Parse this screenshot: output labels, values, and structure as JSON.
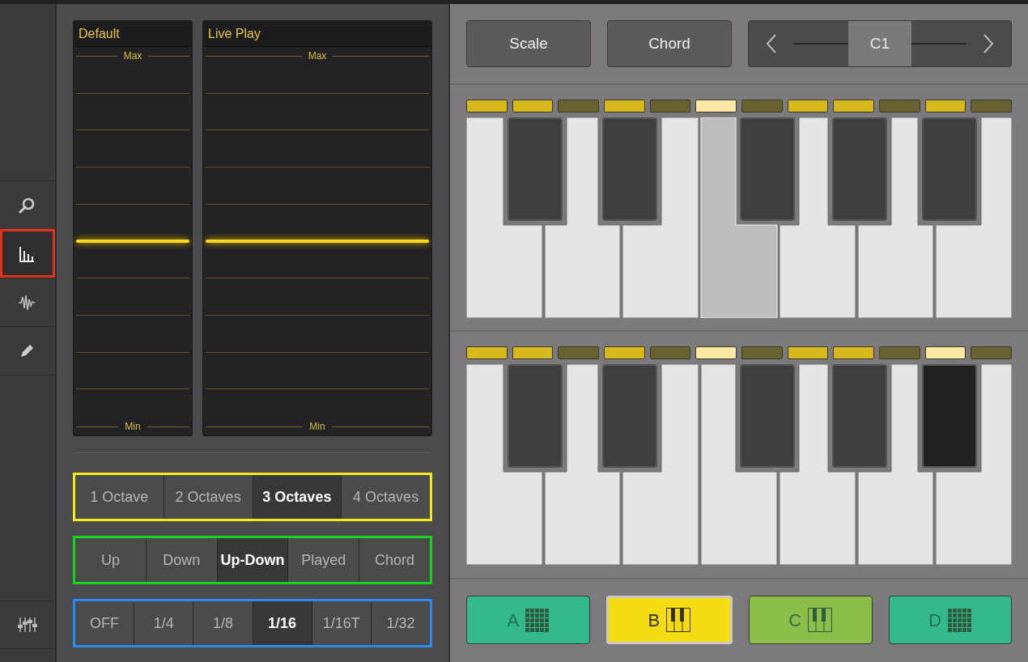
{
  "sidebar": {
    "items": [
      {
        "kind": "search",
        "selected": false,
        "highlighted": false
      },
      {
        "kind": "bars",
        "selected": true,
        "highlighted": true
      },
      {
        "kind": "wave",
        "selected": false,
        "highlighted": false
      },
      {
        "kind": "pencil",
        "selected": false,
        "highlighted": false
      }
    ],
    "footer": {
      "kind": "mixer"
    }
  },
  "sliders": [
    {
      "title": "Default",
      "max_label": "Max",
      "min_label": "Min"
    },
    {
      "title": "Live Play",
      "max_label": "Max",
      "min_label": "Min"
    }
  ],
  "segment_groups": [
    {
      "color": "#f5ea14",
      "options": [
        {
          "label": "1 Octave",
          "selected": false
        },
        {
          "label": "2 Octaves",
          "selected": false
        },
        {
          "label": "3 Octaves",
          "selected": true
        },
        {
          "label": "4 Octaves",
          "selected": false
        }
      ]
    },
    {
      "color": "#16d61c",
      "options": [
        {
          "label": "Up",
          "selected": false
        },
        {
          "label": "Down",
          "selected": false
        },
        {
          "label": "Up-Down",
          "selected": true
        },
        {
          "label": "Played",
          "selected": false
        },
        {
          "label": "Chord",
          "selected": false
        }
      ]
    },
    {
      "color": "#2b8cf0",
      "options": [
        {
          "label": "OFF",
          "selected": false
        },
        {
          "label": "1/4",
          "selected": false
        },
        {
          "label": "1/8",
          "selected": false
        },
        {
          "label": "1/16",
          "selected": true
        },
        {
          "label": "1/16T",
          "selected": false
        },
        {
          "label": "1/32",
          "selected": false
        }
      ]
    }
  ],
  "toolbar": {
    "buttons": [
      "Scale",
      "Chord"
    ],
    "octave": "C1"
  },
  "keyboards": [
    {
      "indicators": [
        {
          "lit": true,
          "playing": false
        },
        {
          "lit": true,
          "playing": false
        },
        {
          "lit": false,
          "playing": false
        },
        {
          "lit": true,
          "playing": false
        },
        {
          "lit": false,
          "playing": false
        },
        {
          "lit": true,
          "playing": true
        },
        {
          "lit": false,
          "playing": false
        },
        {
          "lit": true,
          "playing": false
        },
        {
          "lit": true,
          "playing": false
        },
        {
          "lit": false,
          "playing": false
        },
        {
          "lit": true,
          "playing": false
        },
        {
          "lit": false,
          "playing": false
        }
      ],
      "keys": [
        false,
        false,
        false,
        false,
        false,
        true,
        false,
        false,
        false,
        false,
        false,
        false
      ]
    },
    {
      "indicators": [
        {
          "lit": true,
          "playing": false
        },
        {
          "lit": true,
          "playing": false
        },
        {
          "lit": false,
          "playing": false
        },
        {
          "lit": true,
          "playing": false
        },
        {
          "lit": false,
          "playing": false
        },
        {
          "lit": true,
          "playing": true
        },
        {
          "lit": false,
          "playing": false
        },
        {
          "lit": true,
          "playing": false
        },
        {
          "lit": true,
          "playing": false
        },
        {
          "lit": false,
          "playing": false
        },
        {
          "lit": true,
          "playing": true
        },
        {
          "lit": false,
          "playing": false
        }
      ],
      "keys": [
        false,
        false,
        false,
        false,
        false,
        false,
        false,
        false,
        false,
        false,
        true,
        false
      ]
    }
  ],
  "pads": [
    {
      "label": "A",
      "kind": "grid",
      "color": "#33b98b",
      "selected": false
    },
    {
      "label": "B",
      "kind": "piano",
      "color": "#f5dc12",
      "selected": true
    },
    {
      "label": "C",
      "kind": "piano",
      "color": "#8bbd48",
      "selected": false
    },
    {
      "label": "D",
      "kind": "grid",
      "color": "#33b98b",
      "selected": false
    }
  ]
}
